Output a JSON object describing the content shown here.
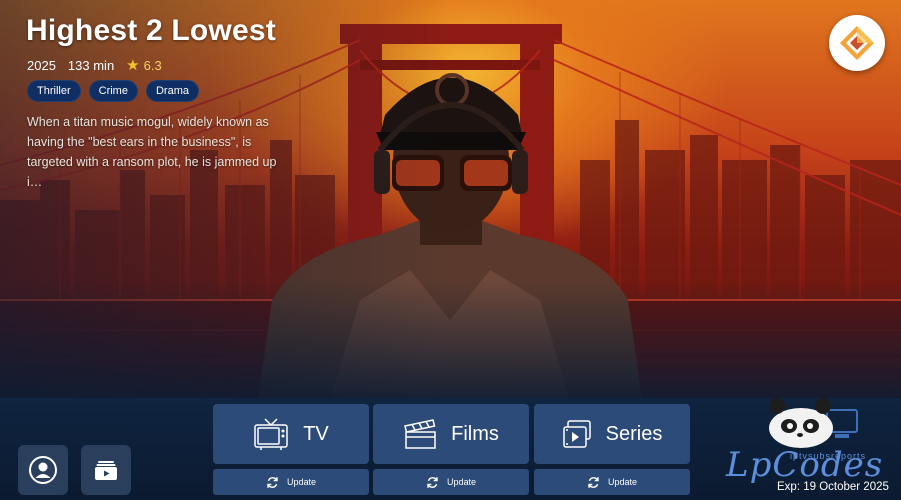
{
  "hero": {
    "title": "Highest 2 Lowest",
    "year": "2025",
    "duration": "133 min",
    "rating": "6.3",
    "genres": [
      "Thriller",
      "Crime",
      "Drama"
    ],
    "description": "When a titan music mogul, widely known as having the \"best ears in the business\", is targeted with a ransom plot, he is jammed up i…"
  },
  "categories": [
    {
      "label": "TV",
      "icon": "tv-icon",
      "update_label": "Update"
    },
    {
      "label": "Films",
      "icon": "clapperboard-icon",
      "update_label": "Update"
    },
    {
      "label": "Series",
      "icon": "series-icon",
      "update_label": "Update"
    }
  ],
  "side_buttons": [
    {
      "icon": "user-icon"
    },
    {
      "icon": "media-library-icon"
    }
  ],
  "branding": {
    "name": "LpCodes",
    "subtitle": "iptvsubsreports",
    "expiry": "Exp: 19 October 2025"
  },
  "colors": {
    "accent": "#2c4b78",
    "chip": "#0f2e63",
    "background": "#0c1c33",
    "brand": "#5c8fdc"
  }
}
